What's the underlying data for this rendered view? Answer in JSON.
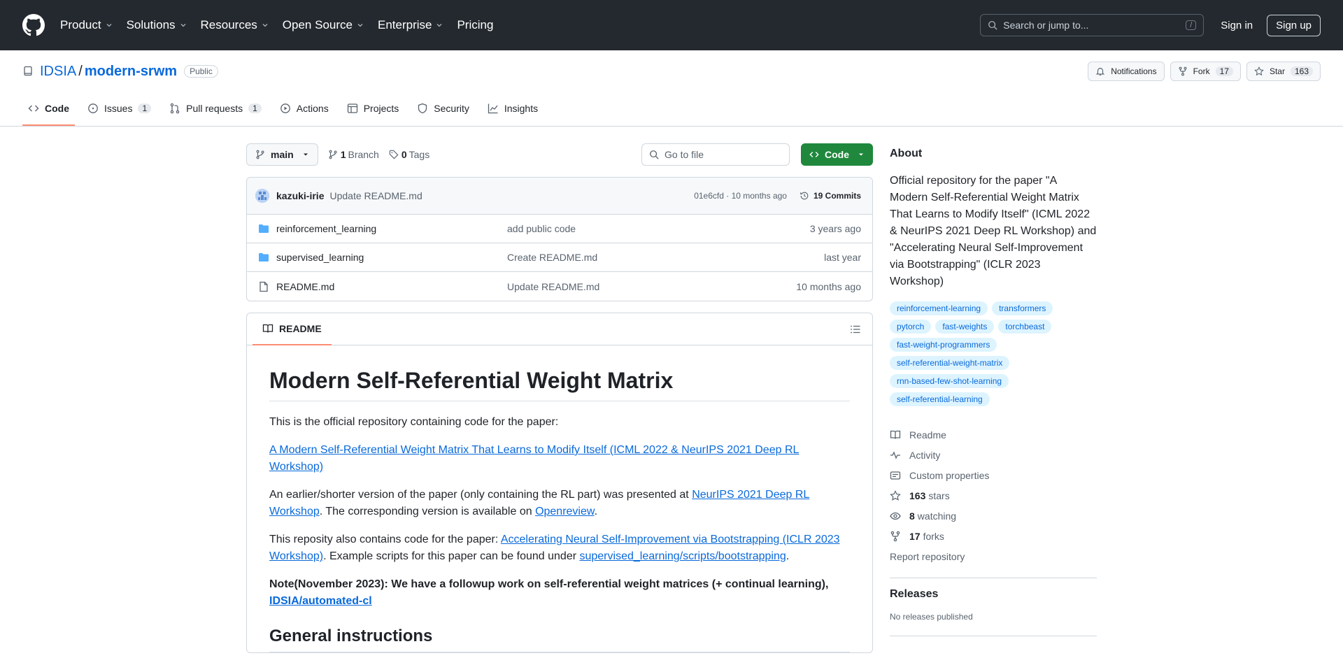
{
  "header": {
    "nav": [
      {
        "label": "Product",
        "has_menu": true
      },
      {
        "label": "Solutions",
        "has_menu": true
      },
      {
        "label": "Resources",
        "has_menu": true
      },
      {
        "label": "Open Source",
        "has_menu": true
      },
      {
        "label": "Enterprise",
        "has_menu": true
      },
      {
        "label": "Pricing",
        "has_menu": false
      }
    ],
    "search_placeholder": "Search or jump to...",
    "search_shortcut": "/",
    "sign_in": "Sign in",
    "sign_up": "Sign up"
  },
  "repo": {
    "owner": "IDSIA",
    "separator": "/",
    "name": "modern-srwm",
    "visibility": "Public",
    "notifications_label": "Notifications",
    "fork_label": "Fork",
    "fork_count": "17",
    "star_label": "Star",
    "star_count": "163"
  },
  "tabs": [
    {
      "label": "Code",
      "icon": "code-icon",
      "count": "",
      "active": true
    },
    {
      "label": "Issues",
      "icon": "issue-icon",
      "count": "1",
      "active": false
    },
    {
      "label": "Pull requests",
      "icon": "pull-request-icon",
      "count": "1",
      "active": false
    },
    {
      "label": "Actions",
      "icon": "play-icon",
      "count": "",
      "active": false
    },
    {
      "label": "Projects",
      "icon": "table-icon",
      "count": "",
      "active": false
    },
    {
      "label": "Security",
      "icon": "shield-icon",
      "count": "",
      "active": false
    },
    {
      "label": "Insights",
      "icon": "graph-icon",
      "count": "",
      "active": false
    }
  ],
  "file_nav": {
    "branch": "main",
    "branch_count": "1",
    "branch_label": "Branch",
    "tag_count": "0",
    "tag_label": "Tags",
    "goto_placeholder": "Go to file",
    "code_button": "Code"
  },
  "latest_commit": {
    "author": "kazuki-irie",
    "message": "Update README.md",
    "meta": "01e6cfd · 10 months ago",
    "commits": "19 Commits"
  },
  "files": [
    {
      "type": "folder",
      "name": "reinforcement_learning",
      "message": "add public code",
      "date": "3 years ago"
    },
    {
      "type": "folder",
      "name": "supervised_learning",
      "message": "Create README.md",
      "date": "last year"
    },
    {
      "type": "file",
      "name": "README.md",
      "message": "Update README.md",
      "date": "10 months ago"
    }
  ],
  "readme": {
    "tab_label": "README",
    "title": "Modern Self-Referential Weight Matrix",
    "p1": "This is the official repository containing code for the paper:",
    "p2_link": "A Modern Self-Referential Weight Matrix That Learns to Modify Itself (ICML 2022 & NeurIPS 2021 Deep RL Workshop)",
    "p3_pre": "An earlier/shorter version of the paper (only containing the RL part) was presented at ",
    "p3_link1": "NeurIPS 2021 Deep RL Workshop",
    "p3_mid": ". The corresponding version is available on ",
    "p3_link2": "Openreview",
    "p3_post": ".",
    "p4_pre": "This reposity also contains code for the paper: ",
    "p4_link1": "Accelerating Neural Self-Improvement via Bootstrapping (ICLR 2023 Workshop)",
    "p4_mid": ". Example scripts for this paper can be found under ",
    "p4_link2": "supervised_learning/scripts/bootstrapping",
    "p4_post": ".",
    "note_text": "Note(November 2023): We have a followup work on self-referential weight matrices (+ continual learning), ",
    "note_link": "IDSIA/automated-cl",
    "h2": "General instructions"
  },
  "about": {
    "heading": "About",
    "description": "Official repository for the paper \"A Modern Self-Referential Weight Matrix That Learns to Modify Itself\" (ICML 2022 & NeurIPS 2021 Deep RL Workshop) and \"Accelerating Neural Self-Improvement via Bootstrapping\" (ICLR 2023 Workshop)",
    "topics": [
      "reinforcement-learning",
      "transformers",
      "pytorch",
      "fast-weights",
      "torchbeast",
      "fast-weight-programmers",
      "self-referential-weight-matrix",
      "rnn-based-few-shot-learning",
      "self-referential-learning"
    ],
    "readme": "Readme",
    "activity": "Activity",
    "custom_properties": "Custom properties",
    "stars_count": "163",
    "stars_label": "stars",
    "watching_count": "8",
    "watching_label": "watching",
    "forks_count": "17",
    "forks_label": "forks",
    "report": "Report repository"
  },
  "releases": {
    "heading": "Releases",
    "empty": "No releases published"
  }
}
